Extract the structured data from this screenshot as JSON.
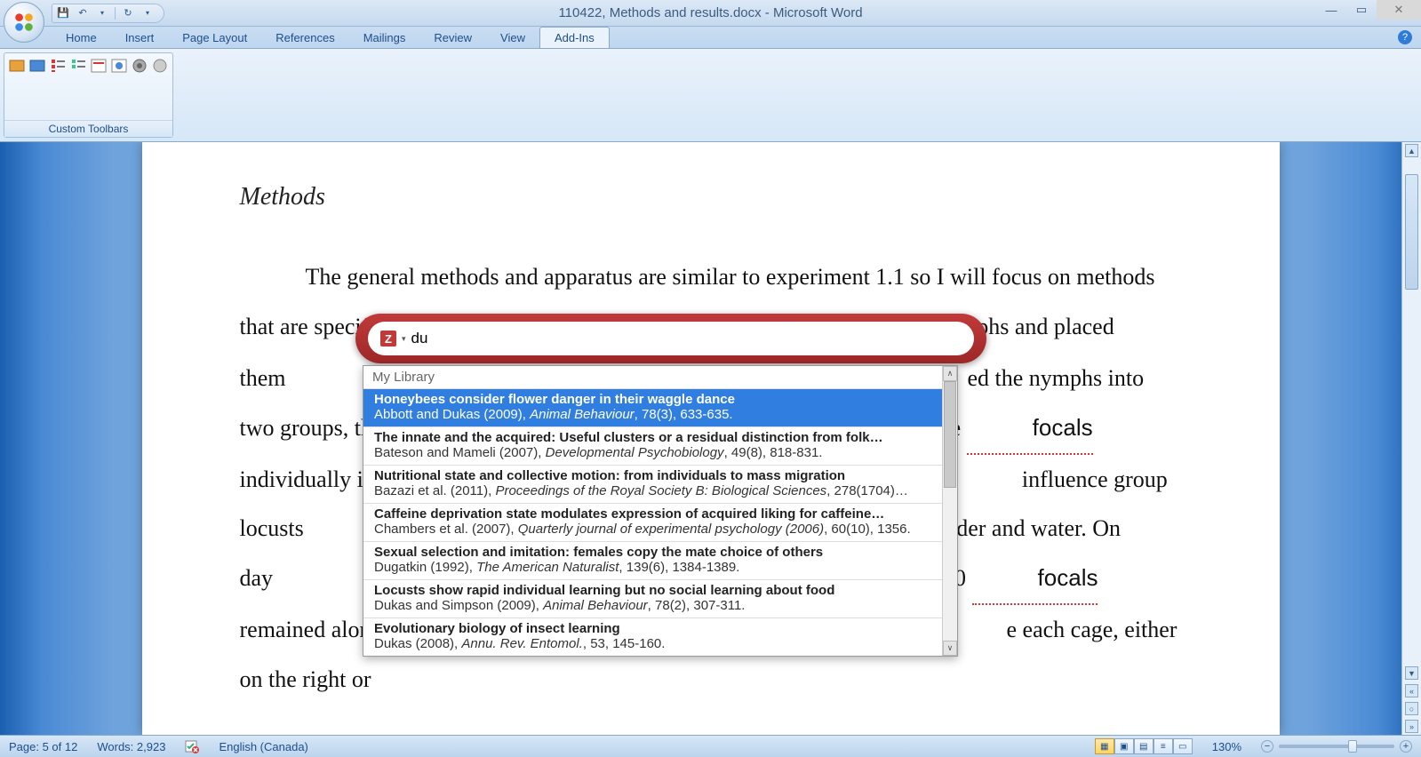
{
  "window": {
    "title": "110422, Methods and results.docx - Microsoft Word"
  },
  "tabs": {
    "items": [
      "Home",
      "Insert",
      "Page Layout",
      "References",
      "Mailings",
      "Review",
      "View",
      "Add-Ins"
    ],
    "active": "Add-Ins"
  },
  "ribbon": {
    "group_label": "Custom Toolbars"
  },
  "document": {
    "heading": "Methods",
    "body": "The general methods and apparatus are similar to experiment 1.1 so I will focus on methods that are specific for this experiment. On day 1, I collected 5th instar nymphs and placed them                                                                                                                                                    ed the nymphs into two groups, the focals {Citation} and the influence group. I placed the focals individually in                                                                                                                                  influence group locusts                                                                                                                                       der and water. On day                                                                                                                                                10 focals remained alon                                                                                                                                           e each cage, either on the right or"
  },
  "zotero": {
    "query": "du",
    "library_label": "My Library",
    "results": [
      {
        "title": "Honeybees consider flower danger in their waggle dance",
        "authors": "Abbott and Dukas (2009)",
        "journal": "Animal Behaviour",
        "cite": "78(3), 633-635."
      },
      {
        "title": "The innate and the acquired: Useful clusters or a residual distinction from folk…",
        "authors": "Bateson and Mameli (2007)",
        "journal": "Developmental Psychobiology",
        "cite": "49(8), 818-831."
      },
      {
        "title": "Nutritional state and collective motion: from individuals to mass migration",
        "authors": "Bazazi et al. (2011)",
        "journal": "Proceedings of the Royal Society B: Biological Sciences",
        "cite": "278(1704)…"
      },
      {
        "title": "Caffeine deprivation state modulates expression of acquired liking for caffeine…",
        "authors": "Chambers et al. (2007)",
        "journal": "Quarterly journal of experimental psychology (2006)",
        "cite": "60(10), 1356."
      },
      {
        "title": "Sexual selection and imitation: females copy the mate choice of others",
        "authors": "Dugatkin (1992)",
        "journal": "The American Naturalist",
        "cite": "139(6), 1384-1389."
      },
      {
        "title": "Locusts show rapid individual learning but no social learning about food",
        "authors": "Dukas and Simpson (2009)",
        "journal": "Animal Behaviour",
        "cite": "78(2), 307-311."
      },
      {
        "title": "Evolutionary biology of insect learning",
        "authors": "Dukas (2008)",
        "journal": "Annu. Rev. Entomol.",
        "cite": "53, 145-160."
      }
    ]
  },
  "status": {
    "page": "Page: 5 of 12",
    "words": "Words: 2,923",
    "language": "English (Canada)",
    "zoom": "130%"
  }
}
